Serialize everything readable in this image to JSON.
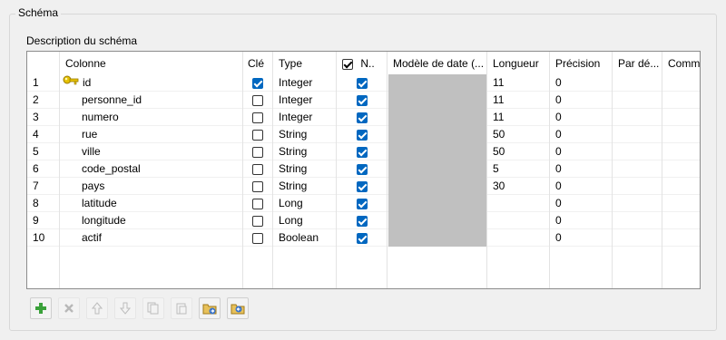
{
  "group_title": "Schéma",
  "description_label": "Description du schéma",
  "columns": {
    "colonne": "Colonne",
    "cle": "Clé",
    "type": "Type",
    "nullable": "N..",
    "modele_date": "Modèle de date (...",
    "longueur": "Longueur",
    "precision": "Précision",
    "par_defaut": "Par dé...",
    "commentaire": "Comme..."
  },
  "rows": [
    {
      "num": "1",
      "name": "id",
      "key_icon": "key-icon",
      "cle": true,
      "type": "Integer",
      "nullable": true,
      "longueur": "11",
      "precision": "0"
    },
    {
      "num": "2",
      "name": "personne_id",
      "cle": false,
      "type": "Integer",
      "nullable": true,
      "longueur": "11",
      "precision": "0"
    },
    {
      "num": "3",
      "name": "numero",
      "cle": false,
      "type": "Integer",
      "nullable": true,
      "longueur": "11",
      "precision": "0"
    },
    {
      "num": "4",
      "name": "rue",
      "cle": false,
      "type": "String",
      "nullable": true,
      "longueur": "50",
      "precision": "0"
    },
    {
      "num": "5",
      "name": "ville",
      "cle": false,
      "type": "String",
      "nullable": true,
      "longueur": "50",
      "precision": "0"
    },
    {
      "num": "6",
      "name": "code_postal",
      "cle": false,
      "type": "String",
      "nullable": true,
      "longueur": "5",
      "precision": "0"
    },
    {
      "num": "7",
      "name": "pays",
      "cle": false,
      "type": "String",
      "nullable": true,
      "longueur": "30",
      "precision": "0"
    },
    {
      "num": "8",
      "name": "latitude",
      "cle": false,
      "type": "Long",
      "nullable": true,
      "longueur": "",
      "precision": "0"
    },
    {
      "num": "9",
      "name": "longitude",
      "cle": false,
      "type": "Long",
      "nullable": true,
      "longueur": "",
      "precision": "0"
    },
    {
      "num": "10",
      "name": "actif",
      "cle": false,
      "type": "Boolean",
      "nullable": true,
      "longueur": "",
      "precision": "0"
    }
  ],
  "toolbar": [
    {
      "icon": "add-icon",
      "enabled": true
    },
    {
      "icon": "delete-icon",
      "enabled": false
    },
    {
      "icon": "move-up-icon",
      "enabled": false
    },
    {
      "icon": "move-down-icon",
      "enabled": false
    },
    {
      "icon": "copy-icon",
      "enabled": false
    },
    {
      "icon": "paste-icon",
      "enabled": false
    },
    {
      "icon": "import-icon",
      "enabled": true
    },
    {
      "icon": "export-icon",
      "enabled": true
    }
  ],
  "colors": {
    "accent": "#0067c0",
    "date_cell": "#c0c0c0",
    "add_green": "#3aa13a"
  }
}
